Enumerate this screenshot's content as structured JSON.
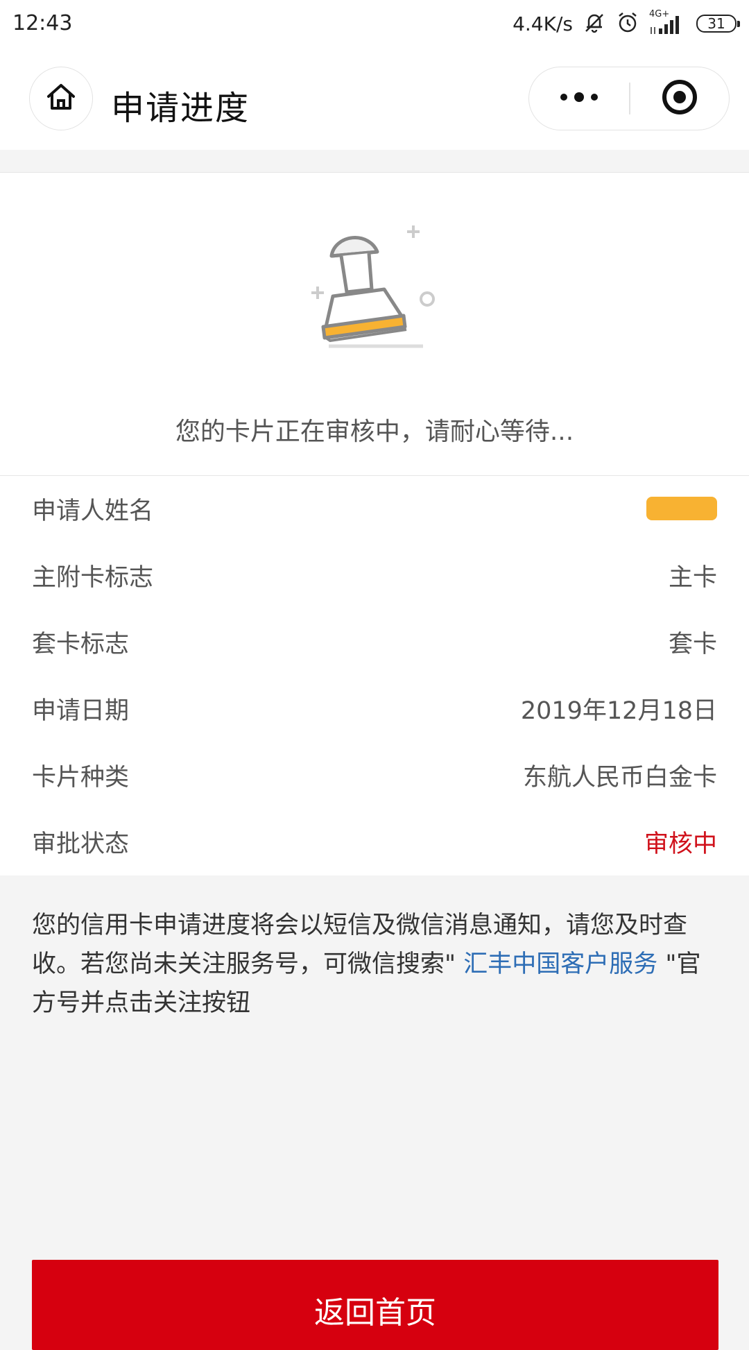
{
  "status_bar": {
    "time": "12:43",
    "net_speed": "4.4K/s",
    "network": "4G+",
    "battery": "31"
  },
  "nav": {
    "title": "申请进度"
  },
  "status": {
    "message": "您的卡片正在审核中，请耐心等待..."
  },
  "details": [
    {
      "label": "申请人姓名",
      "value": "",
      "redacted": true
    },
    {
      "label": "主附卡标志",
      "value": "主卡"
    },
    {
      "label": "套卡标志",
      "value": "套卡"
    },
    {
      "label": "申请日期",
      "value": "2019年12月18日"
    },
    {
      "label": "卡片种类",
      "value": "东航人民币白金卡"
    },
    {
      "label": "审批状态",
      "value": "审核中",
      "color": "#d0111b"
    }
  ],
  "notice": {
    "before": "您的信用卡申请进度将会以短信及微信消息通知，请您及时查收。若您尚未关注服务号，可微信搜索\" ",
    "link": "汇丰中国客户服务",
    "after": " \"官方号并点击关注按钮"
  },
  "button": {
    "label": "返回首页"
  },
  "colors": {
    "accent_red": "#d6000f",
    "status_red": "#d0111b",
    "link_blue": "#2d6db5",
    "stamp_orange": "#f8b232"
  }
}
